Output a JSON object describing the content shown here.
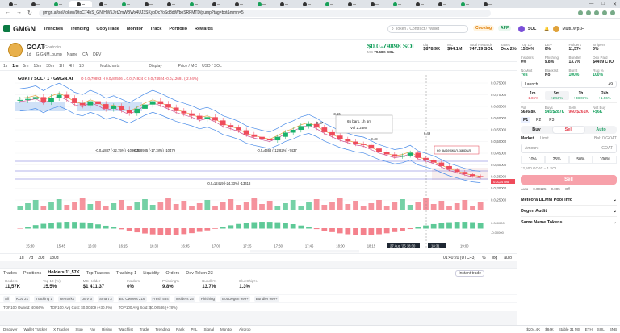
{
  "browser": {
    "url": "gmgn.ai/sol/token/DtoC74bS_GNtHW5JetZmWBWx4UJ3SKyoDcYoSd3dtWboSRFMTD/pump?tag=bot&mmn=5",
    "nav_back": "←",
    "nav_forward": "→",
    "nav_reload": "↻",
    "min": "—",
    "max": "□",
    "close": "✕"
  },
  "app": {
    "logo": "GMGN",
    "nav": [
      "Trenches",
      "Trending",
      "CopyTrade",
      "Monitor",
      "Track",
      "Portfolio",
      "Rewards"
    ],
    "search_placeholder": "Token / Contract / Wallet",
    "cooking": "Cooking",
    "app_btn": "APP",
    "chain": "SOL",
    "wallet": "Multi..Wp1F"
  },
  "token": {
    "symbol": "GOAT",
    "fullname": "Goatcoin",
    "sub": [
      "1d",
      "G.GNM..pump",
      "Name",
      "CA",
      "DEV"
    ],
    "price": "$0.0₄79898 SOL",
    "mc_label": "MC",
    "mc_value": "79.68K SOL",
    "stats": [
      {
        "k": "Liq",
        "v": "$878.9K"
      },
      {
        "k": "MC",
        "v": "$44.1M"
      },
      {
        "k": "Total Rewards",
        "v": "747.19 SOL"
      },
      {
        "k": "Taxes",
        "v": "Dex 2%"
      }
    ]
  },
  "toolbar": {
    "intervals": [
      "1s",
      "1m",
      "5m",
      "15m",
      "30m",
      "1H",
      "4H",
      "1D"
    ],
    "selected": "1m",
    "items": [
      "Multicharts",
      "Display",
      "Price / MC",
      "USD / SOL"
    ]
  },
  "chart_data": {
    "type": "candlestick",
    "title": "GOAT / SOL · 1 · GMGN.AI",
    "ohlc_label": "O 0.0₄79893  H 0.0₄82506  L 0.0₄74924  C 0.0₄74924  -0.0₄12691 (-2.94%)",
    "xlabels": [
      "15:30",
      "15:45",
      "16:00",
      "16:15",
      "16:30",
      "16:45",
      "17:00",
      "17:15",
      "17:30",
      "17:45",
      "18:00",
      "18:15",
      "18:30",
      "18:45",
      "19:00"
    ],
    "ylabels": [
      "0.0₄75000",
      "0.0₄70000",
      "0.0₄65000",
      "0.0₄60000",
      "0.0₄55000",
      "0.0₄50000",
      "0.0₄45000",
      "0.0₄40000",
      "0.0₄35000",
      "0.0₄30000",
      "0.0₄25000"
    ],
    "current_label": "0.0₄34795",
    "macd_labels": [
      "0.000000",
      "-0.00000"
    ],
    "annotations": [
      "-0.0₄1887 (-22.75%) -1098.26",
      "-0.0₄8985 (-17.18%) -10479",
      "-0.0₄12419 (-24.33%) -13418",
      "-0.0₄4368 (-12.82%) -7437",
      "65 bars, 1h 5m",
      "Vol 2.25M",
      "не выдержал, закрыл",
      "0.47",
      "-3.66",
      "-3.48",
      "6.49"
    ],
    "closes": [
      6.78e-05,
      6.82e-05,
      6.9e-05,
      6.7e-05,
      6.88e-05,
      7e-05,
      6.84e-05,
      6.64e-05,
      6.55e-05,
      6.72e-05,
      6.6e-05,
      6.4e-05,
      6.5e-05,
      6.36e-05,
      6.22e-05,
      6.4e-05,
      6.58e-05,
      6.72e-05,
      6.6e-05,
      6.45e-05,
      6.3e-05,
      6.2e-05,
      6.1e-05,
      5.96e-05,
      6.04e-05,
      5.9e-05,
      5.7e-05,
      5.6e-05,
      5.48e-05,
      5.3e-05,
      5.2e-05,
      5.12e-05,
      5.05e-05,
      5.2e-05,
      5.38e-05,
      5.5e-05,
      5.66e-05,
      5.75e-05,
      5.6e-05,
      5.4e-05,
      5.25e-05,
      5.1e-05,
      5e-05,
      4.9e-05,
      4.85e-05,
      4.7e-05,
      4.55e-05,
      4.45e-05,
      4.35e-05,
      4.4e-05,
      4.52e-05,
      4.3e-05,
      4.2e-05,
      4.1e-05,
      3.95e-05,
      3.8e-05,
      3.7e-05,
      3.6e-05,
      3.52e-05,
      3.48e-05
    ],
    "cursor_time": "27 Aug '25   18:30",
    "cursor_time2": "18:31"
  },
  "bottombar": {
    "ranges": [
      "1d",
      "7d",
      "30d",
      "180d"
    ],
    "clock": "01:40:20 (UTC+3)",
    "opts": [
      "%",
      "log",
      "auto"
    ]
  },
  "panel": {
    "tabs": [
      "Trades",
      "Positions",
      "Holders 11,57K",
      "Top Traders",
      "Tracking 1",
      "Liquidity",
      "Orders",
      "Dev Token 23"
    ],
    "selected": "Holders 11,57K",
    "instant": "Instant trade",
    "stats": [
      {
        "k": "Holders",
        "v": "11,57K"
      },
      {
        "k": "Top 10 (%)",
        "v": "15.5%"
      },
      {
        "k": "MC Holder",
        "v": "$1 411,37"
      },
      {
        "k": "Insiders",
        "v": "0%"
      },
      {
        "k": "Phishing%",
        "v": "9.8%"
      },
      {
        "k": "Bundle%",
        "v": "13.7%"
      },
      {
        "k": "BlueChip%",
        "v": "1.3%"
      }
    ],
    "filters": [
      "All",
      "KOL 21",
      "Tracking 1",
      "Remarks",
      "DEV 3",
      "Smart 3",
      "BC Owners 216",
      "Fresh 584",
      "Insiders 25",
      "Phishing",
      "Bot Degen 999+",
      "Bundler 999+"
    ],
    "top10": [
      "TOP100 Owned: 40.66%",
      "TOP100 Avg Cost: $0.00409 (+30.9%)",
      "TOP100 Avg Sold: $0.00586 (+78%)"
    ]
  },
  "right": {
    "grid": [
      {
        "k": "Top 10",
        "v": "15.54%"
      },
      {
        "k": "DEV",
        "v": "0%"
      },
      {
        "k": "Holders",
        "v": "11,574"
      },
      {
        "k": "Snipers",
        "v": "0%"
      },
      {
        "k": "Insiders",
        "v": "0%"
      },
      {
        "k": "Phishing",
        "v": "9.8%"
      },
      {
        "k": "Bundler",
        "v": "13.7%"
      },
      {
        "k": "Dex Paid",
        "v": "$4499 CTO"
      },
      {
        "k": "NoMint",
        "v": "Yes"
      },
      {
        "k": "Blacklist",
        "v": "No"
      },
      {
        "k": "Burnt",
        "v": "100%"
      },
      {
        "k": "Rug %",
        "v": "100%"
      }
    ],
    "launch_label": "Launch",
    "launch_val": "49",
    "tf": [
      {
        "k": "1m",
        "v": "-1.86%"
      },
      {
        "k": "5m",
        "v": "+2.56%"
      },
      {
        "k": "1h",
        "v": "+38.01%"
      },
      {
        "k": "24h",
        "v": "+1.96%"
      }
    ],
    "tf_selected": "5m",
    "vol": [
      {
        "k": "Vol",
        "v": "$636.8K"
      },
      {
        "k": "Buys",
        "v": "545/$287K"
      },
      {
        "k": "Sells",
        "v": "960/$261K"
      },
      {
        "k": "Net Buy",
        "v": "+$6K"
      }
    ],
    "presets": [
      "P1",
      "P2",
      "P3"
    ],
    "buy": "Buy",
    "sell": "Sell",
    "auto": "Auto",
    "order_types": [
      "Market",
      "Limit"
    ],
    "bal": "Bal: 0 GOAT",
    "amount_label": "Amount",
    "amount_unit": "GOAT",
    "pcts": [
      "10%",
      "25%",
      "50%",
      "100%"
    ],
    "quote": "12,500 GOAT = 1 SOL",
    "sell_btn": "Sell",
    "opts": [
      "Auto",
      "0.00125",
      "0.005",
      "Off"
    ],
    "sections": [
      "Meteora DLMM Pool info",
      "Degen Audit",
      "Same Name Tokens"
    ]
  },
  "status": {
    "items": [
      "Discover",
      "Wallet Tracker",
      "X Tracker",
      "Stop",
      "Fav",
      "Rising",
      "Watchlist",
      "Trade",
      "Trending",
      "Rank",
      "PnL",
      "Signal",
      "Monitor",
      "Airdrop"
    ],
    "right": [
      "$204.4K",
      "$84K",
      "Stable 31 MS",
      "ETH",
      "SOL",
      "BNB"
    ]
  },
  "colors": {
    "up": "#19b26b",
    "down": "#ef4b5b",
    "accent": "#0b7a43"
  }
}
